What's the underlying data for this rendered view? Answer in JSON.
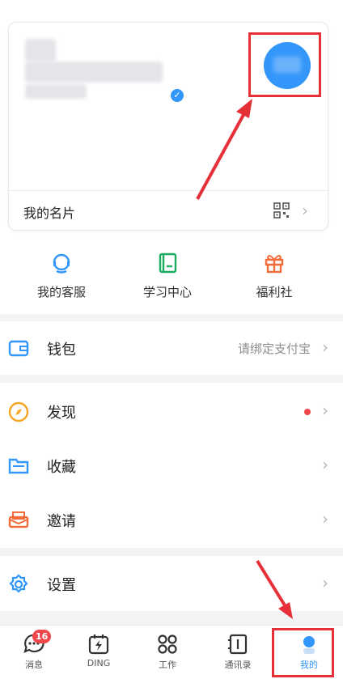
{
  "profile": {
    "card_label": "我的名片"
  },
  "quick_actions": [
    {
      "label": "我的客服",
      "icon": "customer-service-icon",
      "color": "#3296fa"
    },
    {
      "label": "学习中心",
      "icon": "book-icon",
      "color": "#1aad5e"
    },
    {
      "label": "福利社",
      "icon": "gift-icon",
      "color": "#f26b3a"
    }
  ],
  "menu": {
    "wallet": {
      "label": "钱包",
      "value": "请绑定支付宝",
      "icon": "wallet-icon"
    },
    "discover": {
      "label": "发现",
      "icon": "compass-icon"
    },
    "favorites": {
      "label": "收藏",
      "icon": "folder-icon"
    },
    "invite": {
      "label": "邀请",
      "icon": "invite-icon"
    },
    "settings": {
      "label": "设置",
      "icon": "gear-icon"
    }
  },
  "tabbar": [
    {
      "label": "消息",
      "icon": "chat-icon",
      "badge": "16"
    },
    {
      "label": "DING",
      "icon": "ding-icon"
    },
    {
      "label": "工作",
      "icon": "apps-icon"
    },
    {
      "label": "通讯录",
      "icon": "contacts-icon"
    },
    {
      "label": "我的",
      "icon": "me-icon",
      "active": true
    }
  ],
  "colors": {
    "accent": "#3296fa",
    "annotation": "#e5303a",
    "badge": "#f0464b"
  }
}
